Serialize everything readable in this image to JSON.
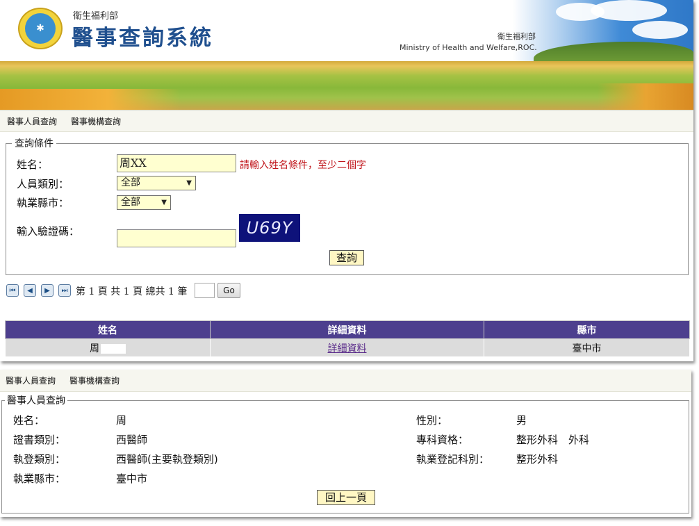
{
  "header": {
    "ministry_small": "衛生福利部",
    "system_title": "醫事查詢系統",
    "ministry_right_zh": "衛生福利部",
    "ministry_right_en": "Ministry of Health and Welfare,ROC."
  },
  "nav": {
    "personnel": "醫事人員查詢",
    "institution": "醫事機構查詢"
  },
  "query": {
    "legend": "查詢條件",
    "name_label": "姓名：",
    "name_value": "周XX",
    "name_hint": "請輸入姓名條件，至少二個字",
    "type_label": "人員類別：",
    "type_value": "全部",
    "city_label": "執業縣市：",
    "city_value": "全部",
    "captcha_label": "輸入驗證碼：",
    "captcha_text": "U69Y",
    "submit": "查詢"
  },
  "pager": {
    "text": "第 1 頁 共 1 頁 總共 1 筆",
    "go": "Go"
  },
  "results": {
    "columns": [
      "姓名",
      "詳細資料",
      "縣市"
    ],
    "rows": [
      {
        "name": "周",
        "detail": "詳細資料",
        "city": "臺中市"
      }
    ]
  },
  "detail": {
    "legend": "醫事人員查詢",
    "name_label": "姓名：",
    "name_value": "周",
    "gender_label": "性別：",
    "gender_value": "男",
    "cert_label": "證書類別：",
    "cert_value": "西醫師",
    "specialty_label": "專科資格：",
    "specialty_value": "整形外科　外科",
    "reg_label": "執登類別：",
    "reg_value": "西醫師(主要執登類別)",
    "dept_label": "執業登記科別：",
    "dept_value": "整形外科",
    "city_label": "執業縣市：",
    "city_value": "臺中市",
    "back": "回上一頁"
  }
}
